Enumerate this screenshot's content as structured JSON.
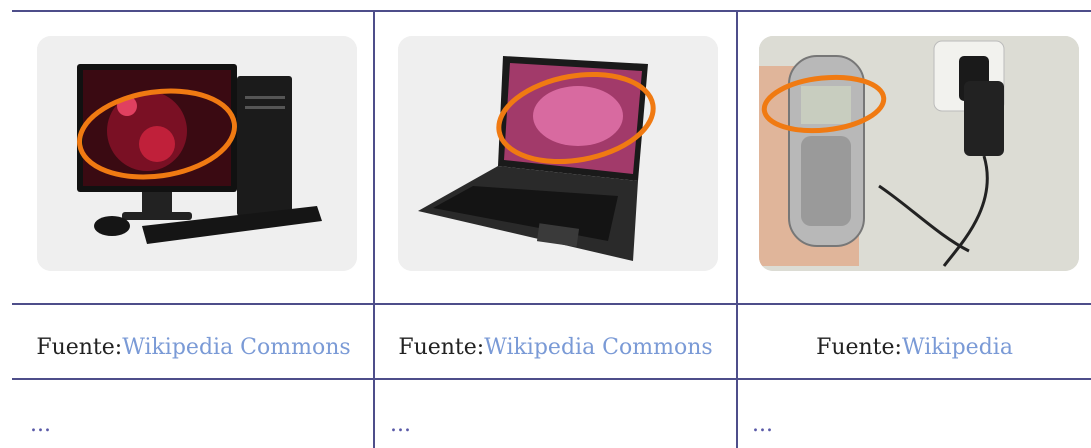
{
  "columns": [
    {
      "image_label": "desktop-computer",
      "caption_prefix": "Fuente: ",
      "caption_link": "Wikipedia Commons",
      "more": "..."
    },
    {
      "image_label": "laptop",
      "caption_prefix": "Fuente: ",
      "caption_link": "Wikipedia Commons",
      "more": "..."
    },
    {
      "image_label": "mobile-phone",
      "caption_prefix": "Fuente: ",
      "caption_link": "Wikipedia",
      "more": "..."
    }
  ],
  "colors": {
    "grid_line": "#4e4e8a",
    "link": "#7a9ad6",
    "highlight_circle": "#f07a12"
  }
}
